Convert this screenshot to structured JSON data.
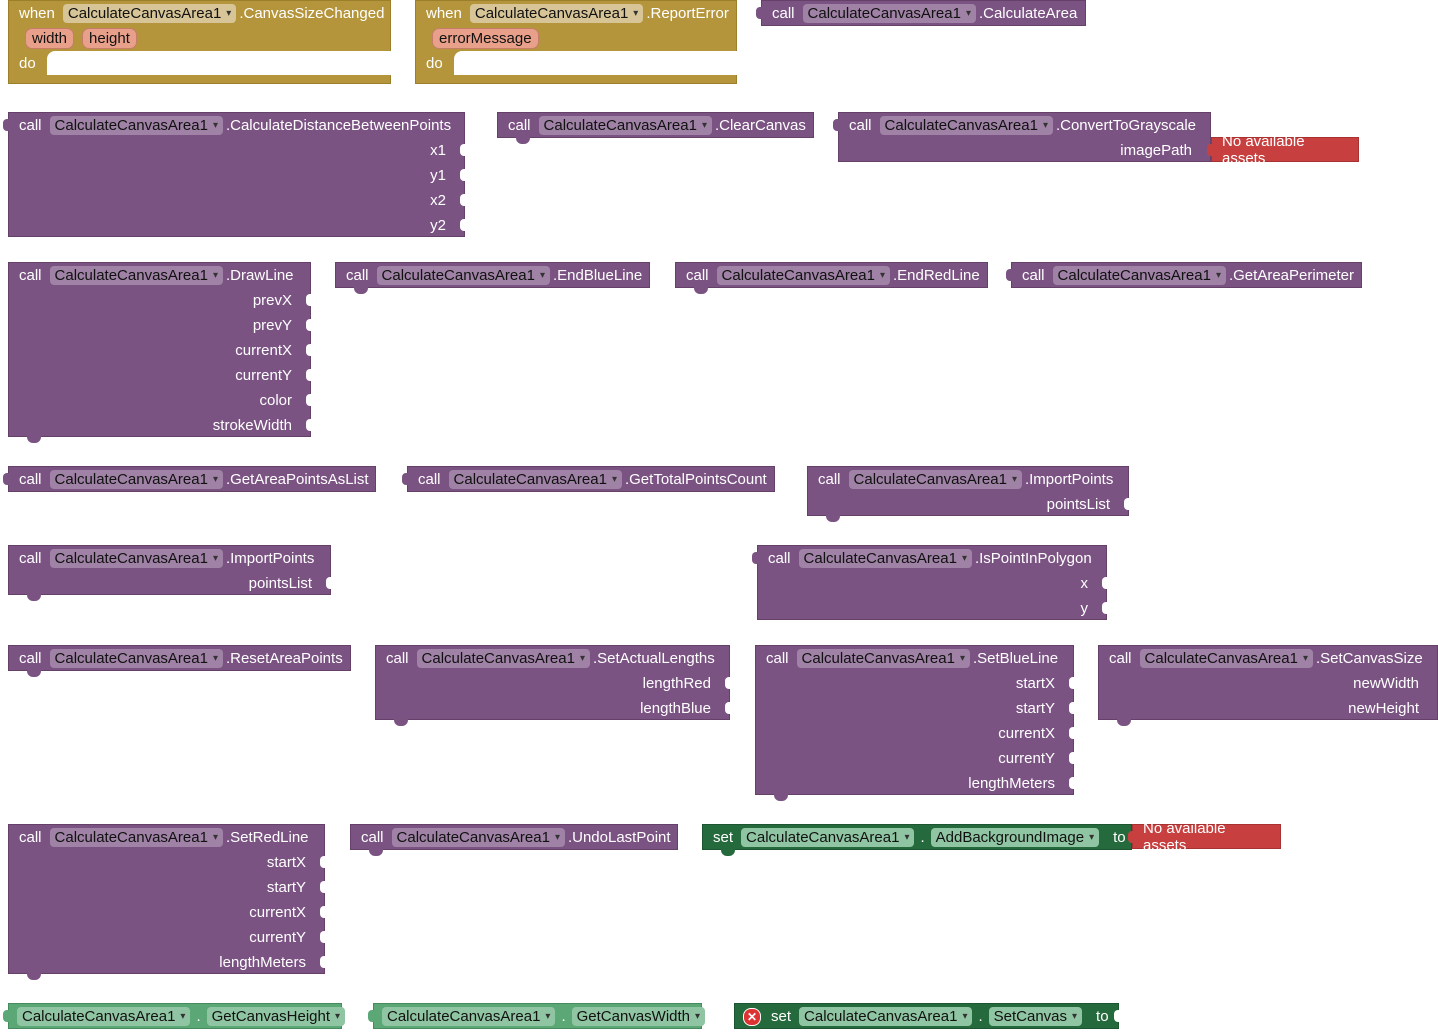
{
  "component": "CalculateCanvasArea1",
  "kw": {
    "when": "when",
    "do": "do",
    "call": "call",
    "set": "set",
    "to": "to",
    "dot": "."
  },
  "no_assets": "No available assets",
  "events": {
    "canvas_size_changed": {
      "name": ".CanvasSizeChanged",
      "params": [
        "width",
        "height"
      ]
    },
    "report_error": {
      "name": ".ReportError",
      "params": [
        "errorMessage"
      ]
    }
  },
  "methods": {
    "calculate_area": {
      "name": ".CalculateArea"
    },
    "distance": {
      "name": ".CalculateDistanceBetweenPoints",
      "params": [
        "x1",
        "y1",
        "x2",
        "y2"
      ]
    },
    "clear_canvas": {
      "name": ".ClearCanvas"
    },
    "grayscale": {
      "name": ".ConvertToGrayscale",
      "params": [
        "imagePath"
      ]
    },
    "draw_line": {
      "name": ".DrawLine",
      "params": [
        "prevX",
        "prevY",
        "currentX",
        "currentY",
        "color",
        "strokeWidth"
      ]
    },
    "end_blue": {
      "name": ".EndBlueLine"
    },
    "end_red": {
      "name": ".EndRedLine"
    },
    "perimeter": {
      "name": ".GetAreaPerimeter"
    },
    "points_list": {
      "name": ".GetAreaPointsAsList"
    },
    "total_points": {
      "name": ".GetTotalPointsCount"
    },
    "import_a": {
      "name": ".ImportPoints",
      "params": [
        "pointsList"
      ]
    },
    "import_b": {
      "name": ".ImportPoints",
      "params": [
        "pointsList"
      ]
    },
    "in_polygon": {
      "name": ".IsPointInPolygon",
      "params": [
        "x",
        "y"
      ]
    },
    "reset": {
      "name": ".ResetAreaPoints"
    },
    "actual_lengths": {
      "name": ".SetActualLengths",
      "params": [
        "lengthRed",
        "lengthBlue"
      ]
    },
    "blue_line": {
      "name": ".SetBlueLine",
      "params": [
        "startX",
        "startY",
        "currentX",
        "currentY",
        "lengthMeters"
      ]
    },
    "canvas_size": {
      "name": ".SetCanvasSize",
      "params": [
        "newWidth",
        "newHeight"
      ]
    },
    "red_line": {
      "name": ".SetRedLine",
      "params": [
        "startX",
        "startY",
        "currentX",
        "currentY",
        "lengthMeters"
      ]
    },
    "undo": {
      "name": ".UndoLastPoint"
    }
  },
  "properties": {
    "add_bg": "AddBackgroundImage",
    "height": "GetCanvasHeight",
    "width": "GetCanvasWidth",
    "set_canvas": "SetCanvas"
  },
  "colors": {
    "method": "#7b5383",
    "event": "#b5953b",
    "setter": "#256a3c",
    "getter": "#5ba876",
    "asset": "#c7403f"
  },
  "icons": {
    "dropdown": "▾",
    "error": "✕"
  }
}
